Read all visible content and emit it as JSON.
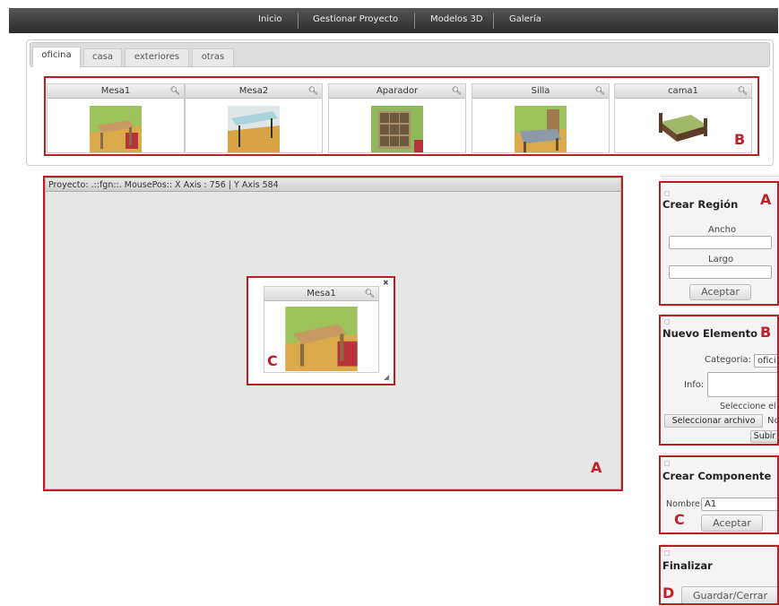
{
  "nav": {
    "items": [
      "Inicio",
      "Gestionar Proyecto",
      "Modelos 3D",
      "Galería"
    ]
  },
  "tabs": [
    {
      "label": "oficina",
      "active": true
    },
    {
      "label": "casa",
      "active": false
    },
    {
      "label": "exteriores",
      "active": false
    },
    {
      "label": "otras",
      "active": false
    }
  ],
  "models": [
    {
      "name": "Mesa1",
      "icon": "zoom-icon"
    },
    {
      "name": "Mesa2",
      "icon": "zoom-icon"
    },
    {
      "name": "Aparador",
      "icon": "zoom-icon"
    },
    {
      "name": "Silla",
      "icon": "zoom-icon"
    },
    {
      "name": "cama1",
      "icon": "zoom-icon"
    }
  ],
  "project": {
    "header": "Proyecto: .::fgn::. MousePos:: X Axis : 756 | Y Axis 584",
    "placed_item": {
      "name": "Mesa1"
    }
  },
  "region_panel": {
    "title": "Crear Región",
    "width_label": "Ancho",
    "length_label": "Largo",
    "button": "Aceptar"
  },
  "element_panel": {
    "title": "Nuevo Elemento",
    "category_label": "Categoria:",
    "category_value": "ofici",
    "info_label": "Info:",
    "select_hint": "Seleccione el a",
    "file_button": "Seleccionar archivo",
    "file_status": "No",
    "upload_button": "Subir"
  },
  "component_panel": {
    "title": "Crear Componente",
    "name_label": "Nombre",
    "name_value": "A1",
    "button": "Aceptar"
  },
  "finish_panel": {
    "title": "Finalizar",
    "button": "Guardar/Cerrar"
  },
  "annotations": {
    "models_box": "B",
    "project_box": "A",
    "item_box": "C",
    "region_box": "A",
    "element_box": "B",
    "component_box": "C",
    "finish_box": "D"
  },
  "colors": {
    "annotation": "#b81f24",
    "navbar": "#3a3a3a"
  }
}
